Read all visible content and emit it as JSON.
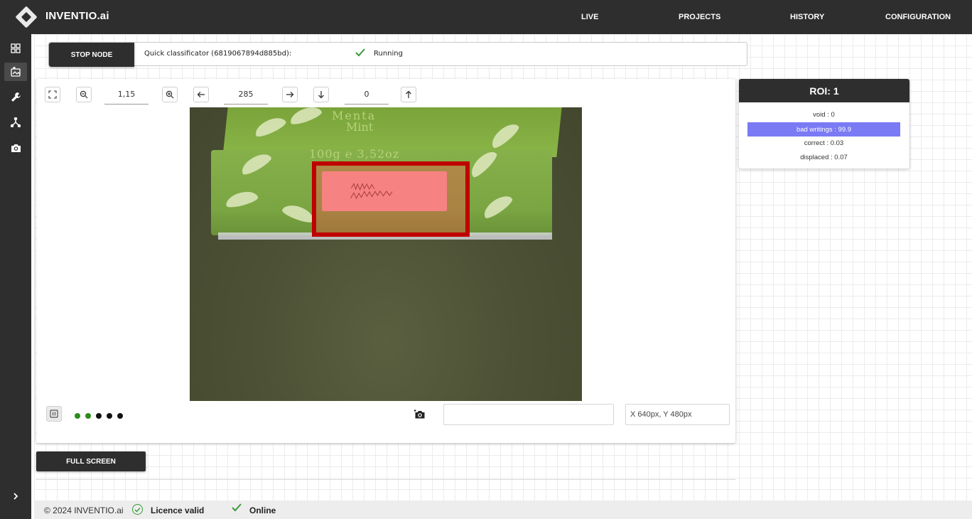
{
  "app": {
    "title": "INVENTIO.ai"
  },
  "nav": {
    "items": [
      {
        "label": "LIVE"
      },
      {
        "label": "PROJECTS"
      },
      {
        "label": "HISTORY"
      },
      {
        "label": "CONFIGURATION"
      }
    ]
  },
  "sidebar": {
    "icons": [
      "dashboard-icon",
      "gallery-icon",
      "wrench-icon",
      "network-icon",
      "camera-icon",
      "chevron-right-icon"
    ],
    "active": "gallery-icon"
  },
  "status": {
    "stop_label": "STOP NODE",
    "node_name": "Quick classificator (6819067894d885bd):",
    "state_label": "Running",
    "state_color": "#3a9a3a"
  },
  "toolbar": {
    "zoom_value": "1,15",
    "x_value": "285",
    "y_value": "0"
  },
  "image": {
    "box_text_line1": "Menta",
    "box_text_line2": "Mint",
    "box_text_line3": "100g ℮ 3,52oz",
    "roi_color": "#c00000"
  },
  "viewer": {
    "dots": [
      {
        "color": "#2e8b1e"
      },
      {
        "color": "#2e8b1e"
      },
      {
        "color": "#111111"
      },
      {
        "color": "#111111"
      },
      {
        "color": "#111111"
      }
    ],
    "name_input_value": "",
    "coords": "X 640px, Y 480px"
  },
  "fullscreen_label": "FULL SCREEN",
  "roi_panel": {
    "title": "ROI: 1",
    "rows": [
      {
        "text": "void : 0",
        "highlight": false
      },
      {
        "text": "bad writings : 99.9",
        "highlight": true
      },
      {
        "text": "correct : 0.03",
        "highlight": false
      },
      {
        "text": "displaced : 0.07",
        "highlight": false
      }
    ],
    "highlight_color": "#7a7af5"
  },
  "footer": {
    "copyright": "© 2024 INVENTIO.ai",
    "licence": "Licence valid",
    "online": "Online"
  }
}
